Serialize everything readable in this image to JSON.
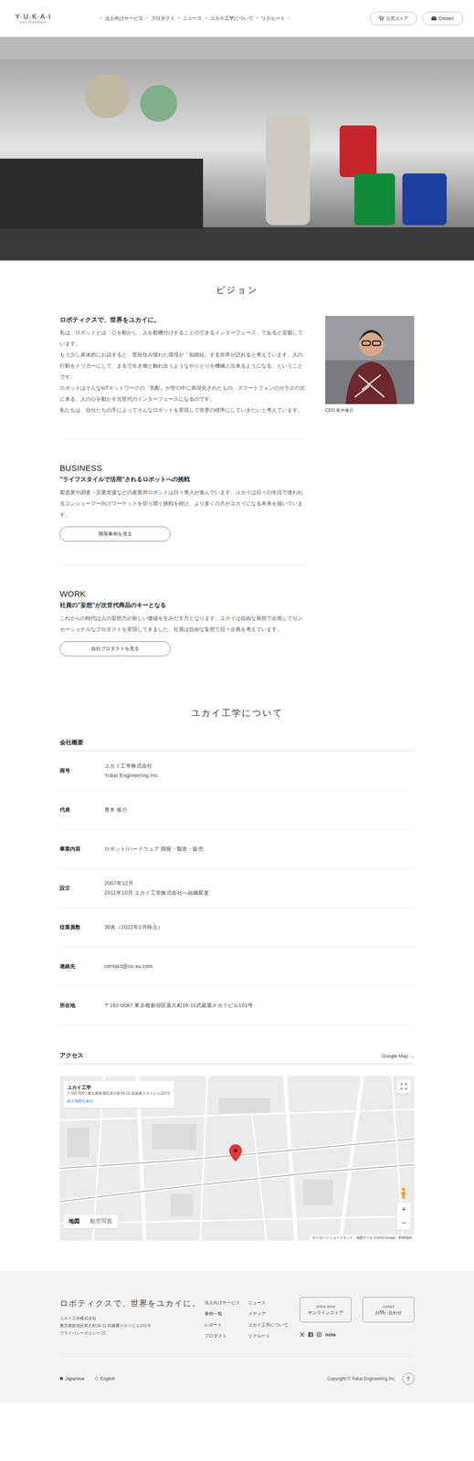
{
  "header": {
    "logo": "Y·U·K·A·I",
    "logo_sub": "ENGINEERING",
    "nav_separator": "•",
    "nav": [
      {
        "label": "法人向けサービス"
      },
      {
        "label": "プロダクト"
      },
      {
        "label": "ニュース"
      },
      {
        "label": "ユカイ工学について"
      },
      {
        "label": "リクルート"
      }
    ],
    "store_button": "公式ストア",
    "contact_button": "Contact"
  },
  "vision": {
    "title": "ビジョン",
    "heading": "ロボティクスで、世界をユカイに。",
    "paragraphs": [
      "私は、ロボットとは「心を動かし、人を動機付けすることのできるインターフェース」であると定義しています。",
      "もう少し具体的にお話すると、普段住み慣れた環境が「知能化」する世界が訪れると考えています。人の行動をトリガーにして、まるで生き物と触れ合うようなやりとりを機械と出来るようになる、ということです。",
      "ロボットはそんなIoTネットワークの「気配」が世の中に具現化されたもの。スマートフォンのガラスの次に来る、人の心を動かす次世代のインターフェースになるのです。",
      "私たちは、自分たちの手によってそんなロボットを実現して世界の標準にしていきたいと考えています。"
    ],
    "caption": "CEO 青木俊介"
  },
  "sections": [
    {
      "label": "BUSINESS",
      "heading": "”ライフスタイルで活用”されるロボットへの挑戦",
      "text": "製造業や調査・災害支援などの産業用ロボットは日々導入が進んでいます。ユカイは日々の生活で使われるコンシューマー向けマーケットを切り開く挑戦を続け、より多くの方がユカイになる未来を描いています。",
      "button": "開発事例を見る"
    },
    {
      "label": "WORK",
      "heading": "社員の”妄想”が次世代商品のキーとなる",
      "text": "これからの時代は人の妄想力が新しい価値を生みだす力となります。ユカイは自由な発想で企画してセンセーショナルなプロダクトを実現してきました。社員は自由な妄想で日々企画を考えています。",
      "button": "自社プロダクトを見る"
    }
  ],
  "about": {
    "title": "ユカイ工学について",
    "overview_title": "会社概要",
    "rows": [
      {
        "label": "商号",
        "lines": [
          "ユカイ工学株式会社",
          "Yukai Engineering Inc."
        ]
      },
      {
        "label": "代表",
        "lines": [
          "青木 俊介"
        ]
      },
      {
        "label": "事業内容",
        "lines": [
          "ロボット/ハードウェア 開発・製造・販売"
        ]
      },
      {
        "label": "設立",
        "lines": [
          "2007年12月",
          "2011年10月 ユカイ工学株式会社へ組織変更"
        ]
      },
      {
        "label": "従業員数",
        "lines": [
          "30名（2022年1月時点）"
        ]
      },
      {
        "label": "連絡先",
        "lines": [
          "contact@ux-xu.com"
        ]
      },
      {
        "label": "所在地",
        "lines": [
          "〒162-0067 東京都新宿区富久町16-11武蔵屋スカイビル101号"
        ]
      }
    ]
  },
  "access": {
    "title": "アクセス",
    "map_link": "Google Map →",
    "map": {
      "place": "ユカイ工学",
      "address": "〒162-0067 東京都新宿区富久町16-11 武蔵屋スカイビル101号",
      "enlarge": "拡大地図を表示",
      "types": [
        {
          "label": "地図",
          "selected": true
        },
        {
          "label": "航空写真",
          "selected": false
        }
      ],
      "zoom_in": "+",
      "zoom_out": "−",
      "attribution": "キーボード ショートカット　地図データ ©2023 Google　利用規約"
    }
  },
  "footer": {
    "tagline": "ロボティクスで、世界をユカイに。",
    "company": "ユカイ工学株式会社",
    "address": "東京都新宿区富久町16-11 武蔵屋スカイビル101号",
    "privacy": "プライバシーポリシー",
    "link_columns": [
      [
        "法人向けサービス",
        "事例一覧",
        "レポート",
        "プロダクト"
      ],
      [
        "ニュース",
        "メディア",
        "ユカイ工学について",
        "リクルート"
      ]
    ],
    "buttons": [
      {
        "top": "online store",
        "bottom": "オンラインストア"
      },
      {
        "top": "contact",
        "bottom": "お問い合わせ"
      }
    ],
    "note_logo": "note",
    "languages": [
      {
        "label": "Japanese",
        "selected": true
      },
      {
        "label": "English",
        "selected": false
      }
    ],
    "copyright": "Copyright © Yukai Engineering Inc."
  }
}
